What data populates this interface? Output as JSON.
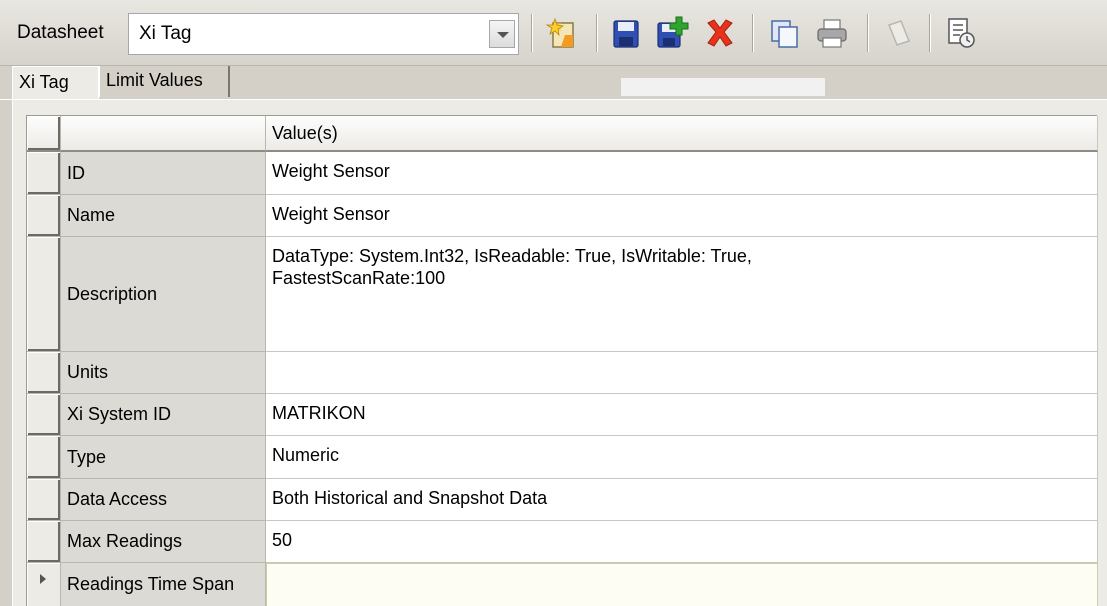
{
  "toolbar": {
    "datasheet_label": "Datasheet",
    "datasheet_value": "Xi Tag",
    "icons": [
      "new-record-icon",
      "save-icon",
      "save-and-new-icon",
      "delete-icon",
      "copy-icon",
      "print-icon",
      "disabled-record-icon",
      "datasheet-options-icon"
    ],
    "colors": {
      "delete": "#e8331c",
      "save": "#2f4fb3",
      "add": "#2ea62e"
    }
  },
  "tabs": [
    {
      "label": "Xi Tag",
      "active": true
    },
    {
      "label": "Limit Values",
      "active": false
    }
  ],
  "grid": {
    "header": {
      "value_col": "Value(s)"
    },
    "rows": [
      {
        "name": "ID",
        "value": "Weight Sensor"
      },
      {
        "name": "Name",
        "value": "Weight Sensor"
      },
      {
        "name": "Description",
        "value": "DataType: System.Int32, IsReadable: True, IsWritable: True,\nFastestScanRate:100"
      },
      {
        "name": "Units",
        "value": ""
      },
      {
        "name": "Xi System ID",
        "value": "MATRIKON"
      },
      {
        "name": "Type",
        "value": "Numeric"
      },
      {
        "name": "Data Access",
        "value": "Both Historical and Snapshot Data"
      },
      {
        "name": "Max Readings",
        "value": "50"
      },
      {
        "name": "Readings Time Span",
        "value": ""
      }
    ]
  }
}
